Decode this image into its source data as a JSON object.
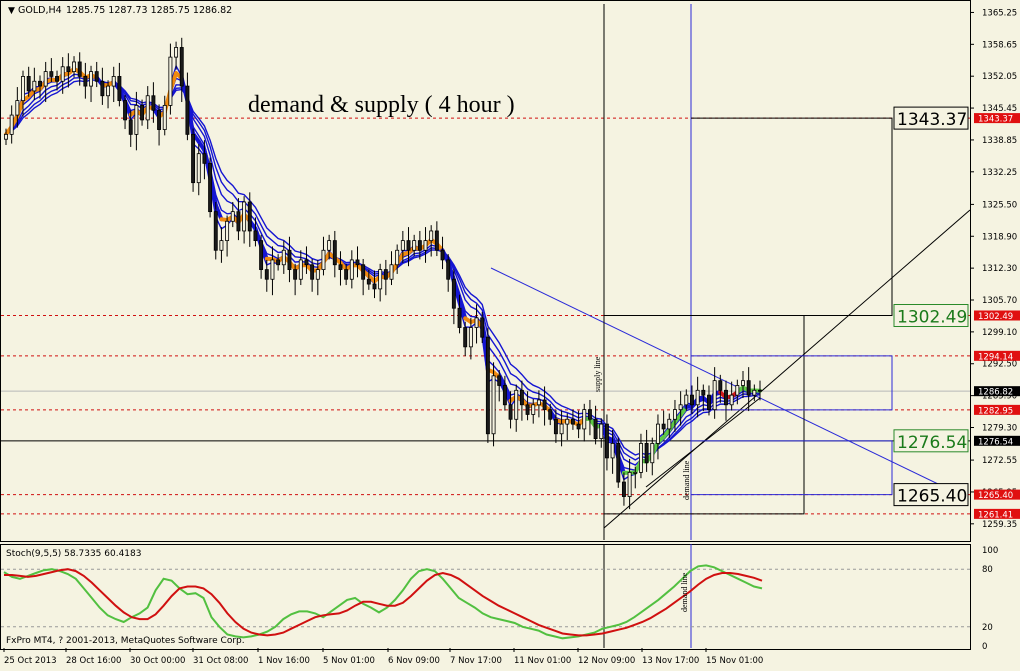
{
  "header": {
    "symbol_label": "GOLD,H4",
    "ohlc": "1285.75 1287.73 1285.75 1286.82"
  },
  "annotations": {
    "title": "demand & supply ( 4 hour )",
    "supply_line": "supply line",
    "demand_line": "demand line",
    "demand_line_lower": "demand line"
  },
  "indicator": {
    "label": "Stoch(9,5,5) 58.7335 60.4183",
    "levels": [
      "100",
      "80",
      "20",
      "0"
    ]
  },
  "footer": {
    "copyright": "FxPro MT4, ? 2001-2013, MetaQuotes Software Corp."
  },
  "colors": {
    "background": "#f5f3e1",
    "bull_candle": "#f5f3e1",
    "bear_candle": "#1a1a1a",
    "ma_orange": "#f08a10",
    "ma_blue": "#1515d2",
    "ma_green": "#5ec846",
    "ma_red": "#d21a1a",
    "level_line": "#d01010",
    "box_line": "#2a2ad8",
    "stoch_main": "#52c040",
    "stoch_signal": "#d01010",
    "price_badge": "#e01010",
    "current_badge": "#000000",
    "green_box_text": "#1a7a1a"
  },
  "chart_data": {
    "type": "candlestick",
    "symbol": "GOLD",
    "timeframe": "H4",
    "title": "demand & supply ( 4 hour )",
    "ylim": [
      1256.0,
      1367.0
    ],
    "y_ticks": [
      "1365.25",
      "1358.65",
      "1352.05",
      "1345.45",
      "1338.85",
      "1332.25",
      "1325.50",
      "1318.90",
      "1312.30",
      "1305.70",
      "1299.10",
      "1292.50",
      "1285.90",
      "1279.30",
      "1272.55",
      "1265.95",
      "1259.35"
    ],
    "x_ticks": [
      "25 Oct 2013",
      "28 Oct 16:00",
      "30 Oct 00:00",
      "31 Oct 08:00",
      "1 Nov 16:00",
      "5 Nov 01:00",
      "6 Nov 09:00",
      "7 Nov 17:00",
      "11 Nov 01:00",
      "12 Nov 09:00",
      "13 Nov 17:00",
      "15 Nov 01:00"
    ],
    "price_levels": [
      {
        "value": 1343.37,
        "label": "1343.37"
      },
      {
        "value": 1302.49,
        "label": "1302.49"
      },
      {
        "value": 1294.14,
        "label": "1294.14"
      },
      {
        "value": 1282.95,
        "label": "1282.95"
      },
      {
        "value": 1265.4,
        "label": "1265.40"
      },
      {
        "value": 1261.41,
        "label": "1261.41"
      }
    ],
    "black_levels": [
      {
        "value": 1276.54,
        "label": "1276.54"
      }
    ],
    "current_price": {
      "value": 1286.82,
      "label": "1286.82"
    },
    "boxed_prices": [
      {
        "value": 1343.37,
        "label": "1343.37",
        "style": "black"
      },
      {
        "value": 1302.49,
        "label": "1302.49",
        "style": "green"
      },
      {
        "value": 1276.54,
        "label": "1276.54",
        "style": "green"
      },
      {
        "value": 1265.4,
        "label": "1265.40",
        "style": "black"
      }
    ],
    "closes": [
      1340,
      1344,
      1347,
      1352,
      1349,
      1351,
      1350,
      1353,
      1352,
      1351,
      1354,
      1353,
      1355,
      1352,
      1350,
      1353,
      1351,
      1348,
      1350,
      1352,
      1347,
      1343,
      1340,
      1346,
      1343,
      1348,
      1345,
      1341,
      1346,
      1356,
      1358,
      1350,
      1340,
      1330,
      1336,
      1334,
      1324,
      1316,
      1318,
      1322,
      1324,
      1320,
      1326,
      1320,
      1318,
      1312,
      1310,
      1314,
      1313,
      1316,
      1312,
      1310,
      1314,
      1313,
      1310,
      1312,
      1316,
      1318,
      1313,
      1312,
      1310,
      1314,
      1313,
      1310,
      1309,
      1308,
      1312,
      1310,
      1313,
      1316,
      1318,
      1316,
      1318,
      1316,
      1318,
      1320,
      1316,
      1314,
      1310,
      1304,
      1300,
      1296,
      1300,
      1302,
      1298,
      1278,
      1290,
      1288,
      1284,
      1281,
      1287,
      1284,
      1282,
      1284,
      1285,
      1283,
      1281,
      1278,
      1280,
      1281,
      1280,
      1279,
      1283,
      1281,
      1277,
      1280,
      1273,
      1276,
      1268,
      1265,
      1270,
      1270,
      1276,
      1272,
      1276,
      1280,
      1279,
      1281,
      1283,
      1284,
      1286,
      1284,
      1287,
      1286,
      1283,
      1289,
      1287,
      1284,
      1286,
      1288,
      1289,
      1286,
      1287,
      1286.82
    ],
    "stoch_main": [
      77,
      72,
      70,
      73,
      76,
      79,
      80,
      78,
      75,
      70,
      60,
      50,
      40,
      32,
      28,
      25,
      30,
      34,
      40,
      58,
      70,
      68,
      60,
      54,
      55,
      50,
      30,
      20,
      12,
      10,
      9,
      10,
      12,
      15,
      20,
      28,
      33,
      36,
      36,
      34,
      30,
      36,
      42,
      48,
      50,
      44,
      40,
      35,
      40,
      48,
      58,
      70,
      78,
      80,
      78,
      70,
      60,
      50,
      45,
      40,
      34,
      30,
      28,
      26,
      24,
      20,
      18,
      16,
      12,
      10,
      8,
      9,
      10,
      12,
      14,
      18,
      20,
      22,
      25,
      30,
      36,
      42,
      48,
      55,
      62,
      70,
      78,
      83,
      84,
      82,
      78,
      74,
      70,
      66,
      62,
      60
    ],
    "stoch_signal": [
      74,
      74,
      73,
      72,
      73,
      75,
      77,
      79,
      80,
      78,
      73,
      66,
      58,
      50,
      42,
      35,
      30,
      28,
      28,
      33,
      42,
      52,
      60,
      62,
      62,
      60,
      54,
      45,
      34,
      25,
      18,
      14,
      12,
      11,
      12,
      14,
      18,
      22,
      26,
      30,
      32,
      33,
      34,
      37,
      42,
      46,
      46,
      44,
      42,
      42,
      45,
      52,
      60,
      68,
      74,
      76,
      74,
      70,
      64,
      58,
      52,
      47,
      42,
      38,
      34,
      30,
      26,
      22,
      19,
      16,
      13,
      12,
      11,
      11,
      12,
      13,
      15,
      17,
      19,
      22,
      25,
      29,
      34,
      39,
      45,
      51,
      57,
      64,
      70,
      74,
      76,
      76,
      75,
      73,
      71,
      68
    ]
  }
}
